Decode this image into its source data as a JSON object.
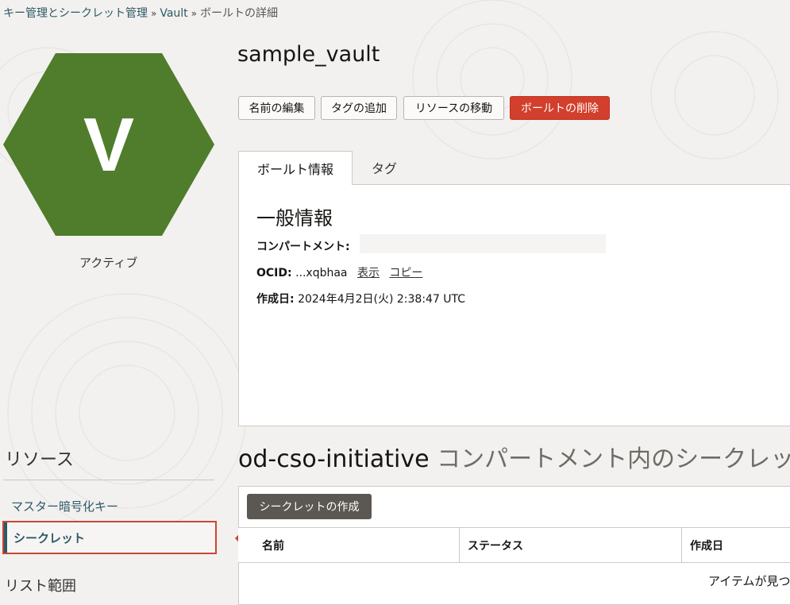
{
  "breadcrumb": {
    "item1": "キー管理とシークレット管理",
    "item2": "Vault",
    "current": "ボールトの詳細",
    "separator": "»"
  },
  "vault": {
    "letter": "V",
    "status": "アクティブ",
    "name": "sample_vault",
    "hex_color": "#4f7d2b"
  },
  "actions": {
    "edit_name": "名前の編集",
    "add_tags": "タグの追加",
    "move_resource": "リソースの移動",
    "delete_vault": "ボールトの削除"
  },
  "tabs": {
    "vault_info": "ボールト情報",
    "tags": "タグ"
  },
  "general_info": {
    "heading": "一般情報",
    "compartment_label": "コンパートメント:",
    "compartment_value": "",
    "ocid_label": "OCID:",
    "ocid_value": "...xqbhaa",
    "show_link": "表示",
    "copy_link": "コピー",
    "created_label": "作成日:",
    "created_value": "2024年4月2日(火) 2:38:47 UTC"
  },
  "resources": {
    "heading": "リソース",
    "master_key": "マスター暗号化キー",
    "secrets": "シークレット",
    "list_scope": "リスト範囲"
  },
  "secrets_section": {
    "compartment": "od-cso-initiative",
    "title_rest": " コンパートメント内のシークレット",
    "create_button": "シークレットの作成",
    "col_name": "名前",
    "col_status": "ステータス",
    "col_created": "作成日",
    "empty_message": "アイテムが見つ"
  },
  "colors": {
    "danger": "#d23f2c",
    "link": "#2c5967",
    "highlight_border": "#c74634"
  }
}
